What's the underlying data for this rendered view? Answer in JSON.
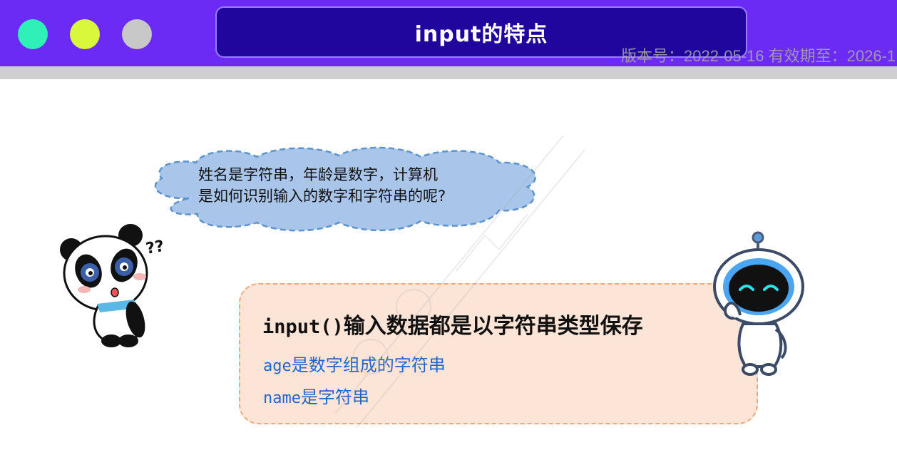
{
  "header": {
    "title": "input的特点",
    "version_text": "版本号：2022-05-16 有效期至：2026-1",
    "window_dots": [
      "green-dot",
      "yellow-dot",
      "grey-dot"
    ]
  },
  "speech_bubble": {
    "line1": "姓名是字符串，年龄是数字，计算机",
    "line2": "是如何识别输入的数字和字符串的呢?"
  },
  "panda": {
    "question_marks": "??"
  },
  "info_card": {
    "heading_code": "input()",
    "heading_text": "输入数据都是以字符串类型保存",
    "line1_code": "age",
    "line1_text": "是数字组成的字符串",
    "line2_code": "name",
    "line2_text": "是字符串"
  },
  "colors": {
    "header": "#6c2bf5",
    "title_box": "#21069e",
    "card_bg": "#fce4d7",
    "card_border": "#f3a876",
    "cloud": "#a9c6ea",
    "accent_text": "#2266cc"
  }
}
